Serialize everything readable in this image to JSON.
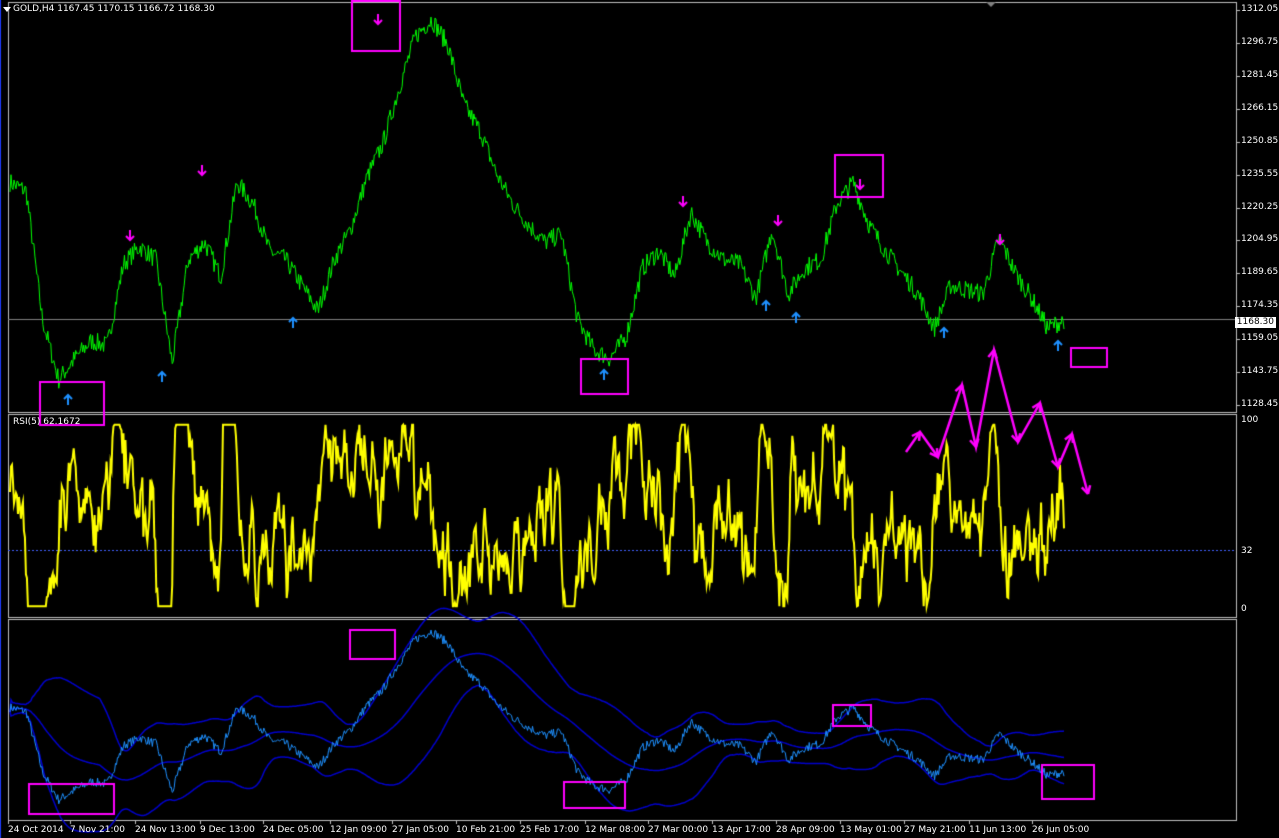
{
  "header": {
    "symbol": "GOLD,H4",
    "ohlc": "1167.45 1170.15 1166.72 1168.30"
  },
  "price_axis": [
    "1312.05",
    "1296.75",
    "1281.45",
    "1266.15",
    "1250.85",
    "1235.55",
    "1220.25",
    "1204.95",
    "1189.65",
    "1174.35",
    "1159.05",
    "1143.75",
    "1128.45"
  ],
  "current_price": "1168.30",
  "rsi": {
    "header": "RSI(5) 62.1672",
    "levels": [
      "100",
      "32",
      "0"
    ],
    "level_value": 32
  },
  "time_axis": [
    "24 Oct 2014",
    "7 Nov 21:00",
    "24 Nov 13:00",
    "9 Dec 13:00",
    "24 Dec 05:00",
    "12 Jan 09:00",
    "27 Jan 05:00",
    "10 Feb 21:00",
    "25 Feb 17:00",
    "12 Mar 08:00",
    "27 Mar 00:00",
    "13 Apr 17:00",
    "28 Apr 09:00",
    "13 May 01:00",
    "27 May 21:00",
    "11 Jun 13:00",
    "26 Jun 05:00"
  ],
  "colors": {
    "price": "#00ff00",
    "rsi": "#ffff00",
    "bottom_line": "#1e90ff",
    "bands": "#0000cd",
    "markers_up": "#1e90ff",
    "markers_down": "#ff00ff",
    "annotation": "#ff00ff",
    "grid": "#c0c0c0"
  },
  "chart_data": {
    "type": "line",
    "price_keypoints": [
      [
        "24 Oct 2014",
        1232
      ],
      [
        "28 Oct",
        1228
      ],
      [
        "1 Nov",
        1168
      ],
      [
        "4 Nov",
        1140
      ],
      [
        "7 Nov",
        1150
      ],
      [
        "10 Nov",
        1158
      ],
      [
        "12 Nov",
        1156
      ],
      [
        "14 Nov",
        1194
      ],
      [
        "18 Nov",
        1202
      ],
      [
        "21 Nov",
        1196
      ],
      [
        "24 Nov",
        1148
      ],
      [
        "26 Nov",
        1196
      ],
      [
        "30 Nov",
        1204
      ],
      [
        "3 Dec",
        1188
      ],
      [
        "5 Dec",
        1232
      ],
      [
        "9 Dec",
        1222
      ],
      [
        "12 Dec",
        1200
      ],
      [
        "16 Dec",
        1196
      ],
      [
        "20 Dec",
        1184
      ],
      [
        "24 Dec",
        1172
      ],
      [
        "29 Dec",
        1196
      ],
      [
        "3 Jan",
        1210
      ],
      [
        "8 Jan",
        1234
      ],
      [
        "12 Jan",
        1250
      ],
      [
        "16 Jan",
        1276
      ],
      [
        "20 Jan",
        1300
      ],
      [
        "22 Jan",
        1308
      ],
      [
        "27 Jan",
        1296
      ],
      [
        "1 Feb",
        1268
      ],
      [
        "5 Feb",
        1256
      ],
      [
        "10 Feb",
        1236
      ],
      [
        "15 Feb",
        1222
      ],
      [
        "20 Feb",
        1212
      ],
      [
        "25 Feb",
        1204
      ],
      [
        "1 Mar",
        1208
      ],
      [
        "6 Mar",
        1168
      ],
      [
        "10 Mar",
        1154
      ],
      [
        "14 Mar",
        1150
      ],
      [
        "17 Mar",
        1160
      ],
      [
        "22 Mar",
        1192
      ],
      [
        "27 Mar",
        1200
      ],
      [
        "31 Mar",
        1188
      ],
      [
        "4 Apr",
        1218
      ],
      [
        "8 Apr",
        1204
      ],
      [
        "13 Apr",
        1196
      ],
      [
        "18 Apr",
        1194
      ],
      [
        "22 Apr",
        1178
      ],
      [
        "25 Apr",
        1210
      ],
      [
        "28 Apr",
        1180
      ],
      [
        "3 May",
        1192
      ],
      [
        "8 May",
        1196
      ],
      [
        "13 May",
        1222
      ],
      [
        "16 May",
        1232
      ],
      [
        "20 May",
        1212
      ],
      [
        "24 May",
        1200
      ],
      [
        "27 May",
        1190
      ],
      [
        "1 Jun",
        1180
      ],
      [
        "4 Jun",
        1164
      ],
      [
        "7 Jun",
        1184
      ],
      [
        "11 Jun",
        1182
      ],
      [
        "15 Jun",
        1180
      ],
      [
        "18 Jun",
        1206
      ],
      [
        "22 Jun",
        1190
      ],
      [
        "26 Jun",
        1178
      ],
      [
        "30 Jun",
        1164
      ],
      [
        "2 Jul",
        1168
      ]
    ],
    "up_markers": [
      1143.75,
      1150,
      1172,
      1150,
      1176,
      1174,
      1166,
      1160
    ],
    "down_markers": [
      1308,
      1206,
      1222,
      1232,
      1214,
      1228,
      1206
    ]
  }
}
